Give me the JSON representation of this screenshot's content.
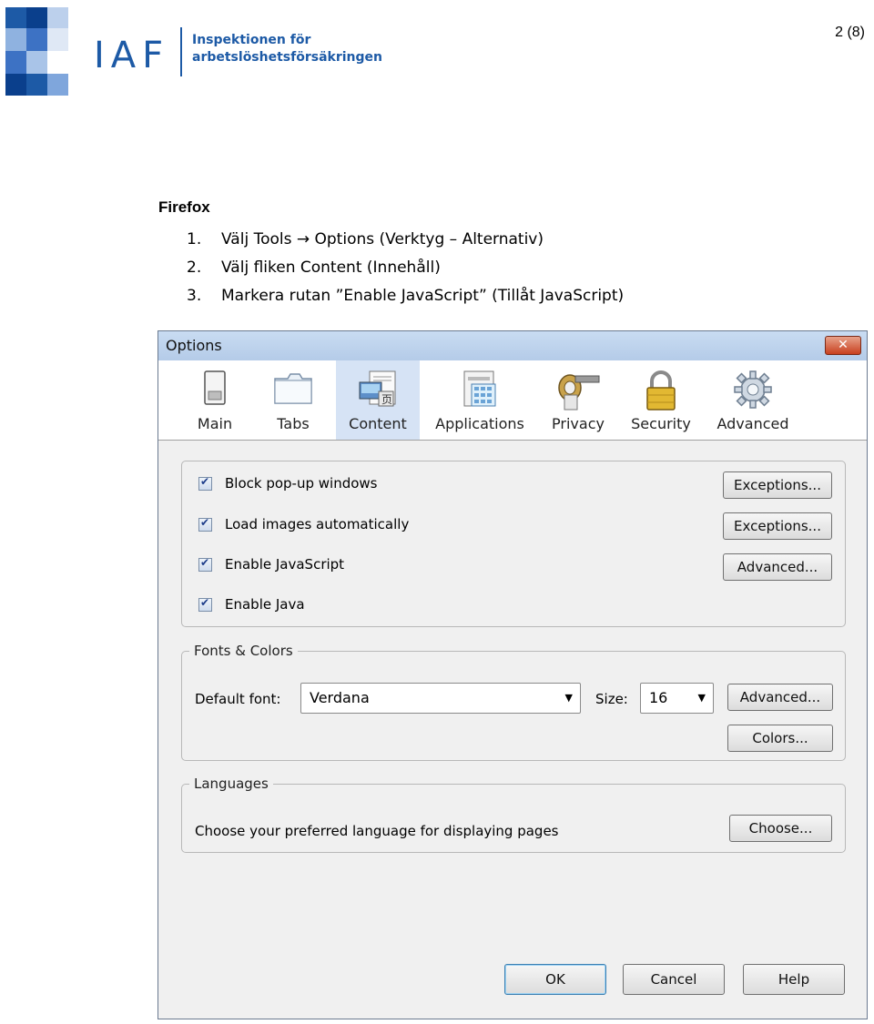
{
  "header": {
    "logo_text": "IAF",
    "org_line1": "Inspektionen för",
    "org_line2": "arbetslöshetsförsäkringen",
    "page_number": "2 (8)"
  },
  "document": {
    "heading": "Firefox",
    "steps": [
      {
        "num": "1.",
        "text": "Välj Tools → Options (Verktyg – Alternativ)"
      },
      {
        "num": "2.",
        "text": "Välj fliken Content (Innehåll)"
      },
      {
        "num": "3.",
        "text": "Markera rutan ”Enable JavaScript” (Tillåt JavaScript)"
      }
    ]
  },
  "dialog": {
    "title": "Options",
    "close_glyph": "✕",
    "tabs": [
      {
        "label": "Main",
        "icon": "main-icon"
      },
      {
        "label": "Tabs",
        "icon": "tabs-icon"
      },
      {
        "label": "Content",
        "icon": "content-icon",
        "selected": true
      },
      {
        "label": "Applications",
        "icon": "applications-icon"
      },
      {
        "label": "Privacy",
        "icon": "privacy-icon"
      },
      {
        "label": "Security",
        "icon": "security-icon"
      },
      {
        "label": "Advanced",
        "icon": "advanced-icon"
      }
    ],
    "content_options": [
      {
        "label": "Block pop-up windows",
        "checked": true,
        "button": "Exceptions..."
      },
      {
        "label": "Load images automatically",
        "checked": true,
        "button": "Exceptions..."
      },
      {
        "label": "Enable JavaScript",
        "checked": true,
        "button": "Advanced..."
      },
      {
        "label": "Enable Java",
        "checked": true
      }
    ],
    "fonts_colors": {
      "legend": "Fonts & Colors",
      "default_font_label": "Default font:",
      "default_font_value": "Verdana",
      "size_label": "Size:",
      "size_value": "16",
      "advanced_button": "Advanced...",
      "colors_button": "Colors..."
    },
    "languages": {
      "legend": "Languages",
      "description": "Choose your preferred language for displaying pages",
      "choose_button": "Choose..."
    },
    "footer": {
      "ok": "OK",
      "cancel": "Cancel",
      "help": "Help"
    },
    "colors": {
      "accent": "#1d5aa6",
      "titlebar": "#c9dcf2",
      "selected_tab": "#d6e3f5"
    }
  }
}
